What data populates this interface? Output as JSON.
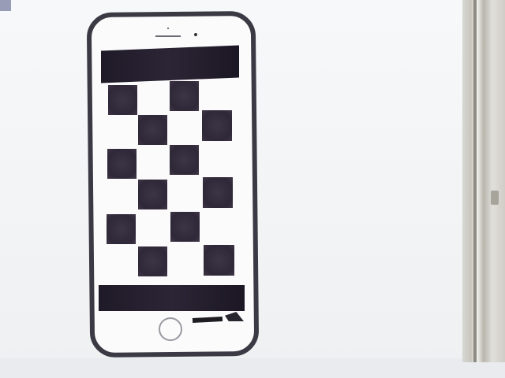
{
  "scene": {
    "subject": "phone",
    "screen_pattern": "checkerboard",
    "colors": {
      "phone_frame": "#3b3a44",
      "dark_square": "#332c3c",
      "screen_background": "#fbfbfc"
    }
  }
}
